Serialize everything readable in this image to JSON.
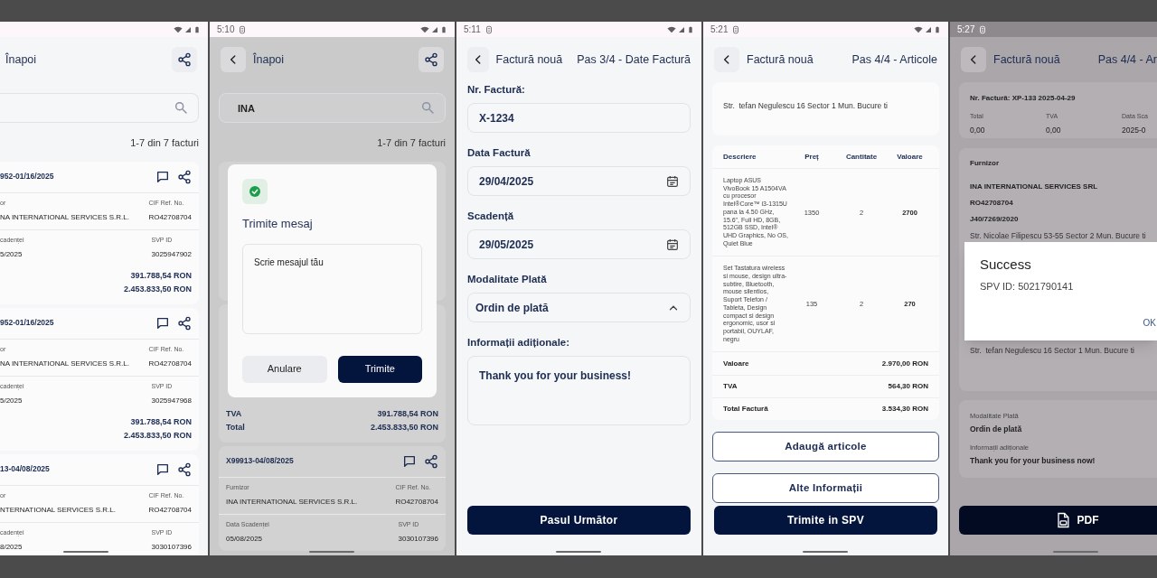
{
  "screens": [
    {
      "kind": "invoice_list",
      "cut_left": true,
      "status_bar": {
        "dimmed": false
      },
      "header": {
        "title": "Înapoi",
        "share": true
      },
      "count": "1-7 din 7 facturi",
      "invoices": [
        {
          "number": "952-01/16/2025",
          "fields": [
            {
              "label": "or",
              "value": "NA INTERNATIONAL SERVICES S.R.L."
            },
            {
              "label": "CIF Ref. No.",
              "value": "RO42708704"
            },
            {
              "label": "cadenței",
              "value": "5/2025"
            },
            {
              "label": "SVP ID",
              "value": "3025947902"
            }
          ],
          "totals": [
            {
              "value": "391.788,54 RON"
            },
            {
              "value": "2.453.833,50 RON"
            }
          ]
        },
        {
          "number": "952-01/16/2025",
          "fields": [
            {
              "label": "or",
              "value": "NA INTERNATIONAL SERVICES S.R.L."
            },
            {
              "label": "CIF Ref. No.",
              "value": "RO42708704"
            },
            {
              "label": "cadenței",
              "value": "5/2025"
            },
            {
              "label": "SVP ID",
              "value": "3025947968"
            }
          ],
          "totals": [
            {
              "value": "391.788,54 RON"
            },
            {
              "value": "2.453.833,50 RON"
            }
          ]
        },
        {
          "number": "13-04/08/2025",
          "fields": [
            {
              "label": "or",
              "value": "NTERNATIONAL SERVICES S.R.L."
            },
            {
              "label": "CIF Ref. No.",
              "value": "RO42708704"
            },
            {
              "label": "cadenței",
              "value": "8/2025"
            },
            {
              "label": "SVP ID",
              "value": "3030107396"
            }
          ]
        }
      ]
    },
    {
      "kind": "invoice_list",
      "dimmed": true,
      "status_bar": {
        "time": "5:10",
        "dimmed": false
      },
      "header": {
        "back_button": true,
        "title": "Înapoi",
        "share": true
      },
      "search": {
        "value": "INA"
      },
      "count": "1-7 din 7 facturi",
      "invoices": [
        {
          "totals": [
            {
              "label": "TVA",
              "value": "391.788,54 RON"
            },
            {
              "label": "Total",
              "value": "2.453.833,50 RON"
            }
          ]
        },
        {
          "number": "X99913-04/08/2025",
          "fields": [
            {
              "label": "Furnizor",
              "value": "INA INTERNATIONAL SERVICES S.R.L."
            },
            {
              "label": "CIF Ref. No.",
              "value": "RO42708704"
            },
            {
              "label": "Data Scadenței",
              "value": "05/08/2025"
            },
            {
              "label": "SVP ID",
              "value": "3030107396"
            }
          ]
        }
      ],
      "dialog": {
        "title": "Trimite mesaj",
        "placeholder": "Scrie mesajul tău",
        "buttons": [
          {
            "label": "Anulare",
            "kind": "secondary"
          },
          {
            "label": "Trimite",
            "kind": "primary"
          }
        ]
      }
    },
    {
      "kind": "invoice_form",
      "status_bar": {
        "time": "5:11",
        "dimmed": false
      },
      "header": {
        "back_button": true,
        "title": "Factură nouă",
        "step": "Pas 3/4 - Date Factură"
      },
      "fields": [
        {
          "kind": "text",
          "label": "Nr. Factură:",
          "value": "X-1234"
        },
        {
          "kind": "date",
          "label": "Data Factură",
          "value": "29/04/2025"
        },
        {
          "kind": "date",
          "label": "Scadență",
          "value": "29/05/2025"
        },
        {
          "kind": "select",
          "label": "Modalitate Plată",
          "value": "Ordin de plată"
        },
        {
          "kind": "textarea",
          "label": "Informații adiționale:",
          "value": "Thank you for your business!"
        }
      ],
      "buttons": [
        {
          "label": "Pasul Următor",
          "kind": "primary"
        }
      ]
    },
    {
      "kind": "invoice_items",
      "status_bar": {
        "time": "5:21",
        "dimmed": false
      },
      "header": {
        "back_button": true,
        "title": "Factură nouă",
        "step": "Pas 4/4 - Articole"
      },
      "address": "Str.  tefan Negulescu 16 Sector 1 Mun. Bucure ti",
      "table": {
        "columns": [
          "Descriere",
          "Preț",
          "Cantitate",
          "Valoare"
        ],
        "rows": [
          [
            "Laptop ASUS VivoBook 15 A1504VA cu procesor Intel®Core™ i3-1315U pana la 4.50 GHz, 15.6\", Full HD, 8GB, 512GB SSD, Intel® UHD Graphics, No OS, Quiet Blue",
            "1350",
            "2",
            "2700"
          ],
          [
            "Set Tastatura wireless si mouse, design ultra-subtire, Bluetooth, mouse silentios, Suport Telefon / Tableta, Design compact si design ergonomic, usor si portabil, OUYLAF, negru",
            "135",
            "2",
            "270"
          ]
        ],
        "totals": [
          {
            "label": "Valoare",
            "value": "2.970,00 RON"
          },
          {
            "label": "TVA",
            "value": "564,30 RON"
          },
          {
            "label": "Total Factură",
            "value": "3.534,30 RON"
          }
        ]
      },
      "buttons": [
        {
          "label": "Adaugă articole",
          "kind": "outlined"
        },
        {
          "label": "Alte Informații",
          "kind": "outlined"
        },
        {
          "label": "Trimite in SPV",
          "kind": "primary"
        }
      ]
    },
    {
      "kind": "invoice_summary",
      "cut_right": true,
      "dimmed": true,
      "status_bar": {
        "time": "5:27",
        "dimmed": true
      },
      "header": {
        "back_button": true,
        "title": "Factură nouă",
        "step": "Pas 4/4 - Ar"
      },
      "summary": {
        "title": "Nr. Factură: XP-133 2025-04-29",
        "stats": [
          {
            "label": "Total",
            "value": "0,00"
          },
          {
            "label": "TVA",
            "value": "0,00"
          },
          {
            "label": "Data Sca",
            "value": "2025-0"
          }
        ]
      },
      "supplier": {
        "heading": "Furnizor",
        "lines": [
          "INA INTERNATIONAL SERVICES SRL",
          "RO42708704",
          "J40/7269/2020"
        ],
        "address": "Str. Nicolae Filipescu 53-55 Sector 2 Mun. Bucure ti",
        "client_address": "Str.  tefan Negulescu 16 Sector 1 Mun. Bucure ti"
      },
      "details": [
        {
          "label": "Modalitate Plată",
          "value": "Ordin de plată"
        },
        {
          "label": "Informații adiționale",
          "value": "Thank you for your business now!"
        }
      ],
      "dialog": {
        "title": "Success",
        "message": "SPV ID: 5021790141",
        "buttons": [
          {
            "label": "OK",
            "kind": "text"
          }
        ]
      },
      "buttons": [
        {
          "label": "PDF",
          "kind": "pdf"
        }
      ]
    }
  ]
}
